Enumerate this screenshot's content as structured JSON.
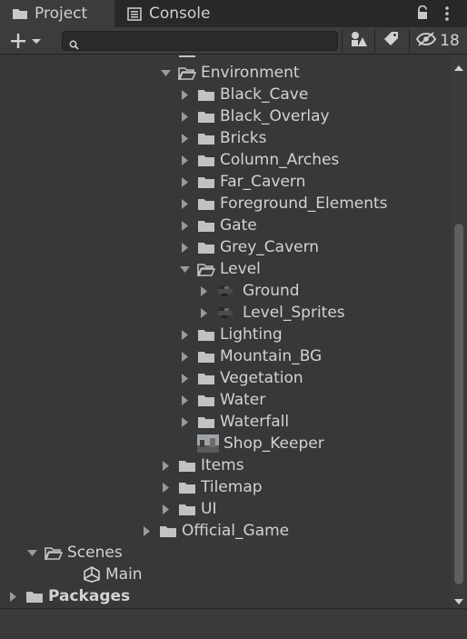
{
  "tabs": [
    {
      "label": "Project",
      "icon": "folder-icon",
      "active": true
    },
    {
      "label": "Console",
      "icon": "console-icon",
      "active": false
    }
  ],
  "toolbar": {
    "search_value": "",
    "hidden_count": "18"
  },
  "tree": [
    {
      "label": "Effects",
      "depth": 8,
      "arrow": "none",
      "icon": "folder",
      "partial": true
    },
    {
      "label": "Environment",
      "depth": 8,
      "arrow": "down",
      "icon": "folder-open"
    },
    {
      "label": "Black_Cave",
      "depth": 9,
      "arrow": "right",
      "icon": "folder"
    },
    {
      "label": "Black_Overlay",
      "depth": 9,
      "arrow": "right",
      "icon": "folder"
    },
    {
      "label": "Bricks",
      "depth": 9,
      "arrow": "right",
      "icon": "folder"
    },
    {
      "label": "Column_Arches",
      "depth": 9,
      "arrow": "right",
      "icon": "folder"
    },
    {
      "label": "Far_Cavern",
      "depth": 9,
      "arrow": "right",
      "icon": "folder"
    },
    {
      "label": "Foreground_Elements",
      "depth": 9,
      "arrow": "right",
      "icon": "folder"
    },
    {
      "label": "Gate",
      "depth": 9,
      "arrow": "right",
      "icon": "folder"
    },
    {
      "label": "Grey_Cavern",
      "depth": 9,
      "arrow": "right",
      "icon": "folder"
    },
    {
      "label": "Level",
      "depth": 9,
      "arrow": "down",
      "icon": "folder-open"
    },
    {
      "label": "Ground",
      "depth": 10,
      "arrow": "right",
      "icon": "sprite"
    },
    {
      "label": "Level_Sprites",
      "depth": 10,
      "arrow": "right",
      "icon": "sprite"
    },
    {
      "label": "Lighting",
      "depth": 9,
      "arrow": "right",
      "icon": "folder"
    },
    {
      "label": "Mountain_BG",
      "depth": 9,
      "arrow": "right",
      "icon": "folder"
    },
    {
      "label": "Vegetation",
      "depth": 9,
      "arrow": "right",
      "icon": "folder"
    },
    {
      "label": "Water",
      "depth": 9,
      "arrow": "right",
      "icon": "folder"
    },
    {
      "label": "Waterfall",
      "depth": 9,
      "arrow": "right",
      "icon": "folder"
    },
    {
      "label": "Shop_Keeper",
      "depth": 9,
      "arrow": "none",
      "icon": "image"
    },
    {
      "label": "Items",
      "depth": 8,
      "arrow": "right",
      "icon": "folder"
    },
    {
      "label": "Tilemap",
      "depth": 8,
      "arrow": "right",
      "icon": "folder"
    },
    {
      "label": "UI",
      "depth": 8,
      "arrow": "right",
      "icon": "folder"
    },
    {
      "label": "Official_Game",
      "depth": 7,
      "arrow": "right",
      "icon": "folder"
    },
    {
      "label": "Scenes",
      "depth": 1,
      "arrow": "down",
      "icon": "folder-open"
    },
    {
      "label": "Main",
      "depth": 3,
      "arrow": "none",
      "icon": "unity"
    },
    {
      "label": "Packages",
      "depth": 0,
      "arrow": "right",
      "icon": "folder",
      "bold": true
    }
  ],
  "colors": {
    "background": "#383838",
    "toolbar": "#3c3c3c",
    "tab_inactive": "#282828",
    "text": "#d2d2d2",
    "folder": "#c2c2c2"
  }
}
